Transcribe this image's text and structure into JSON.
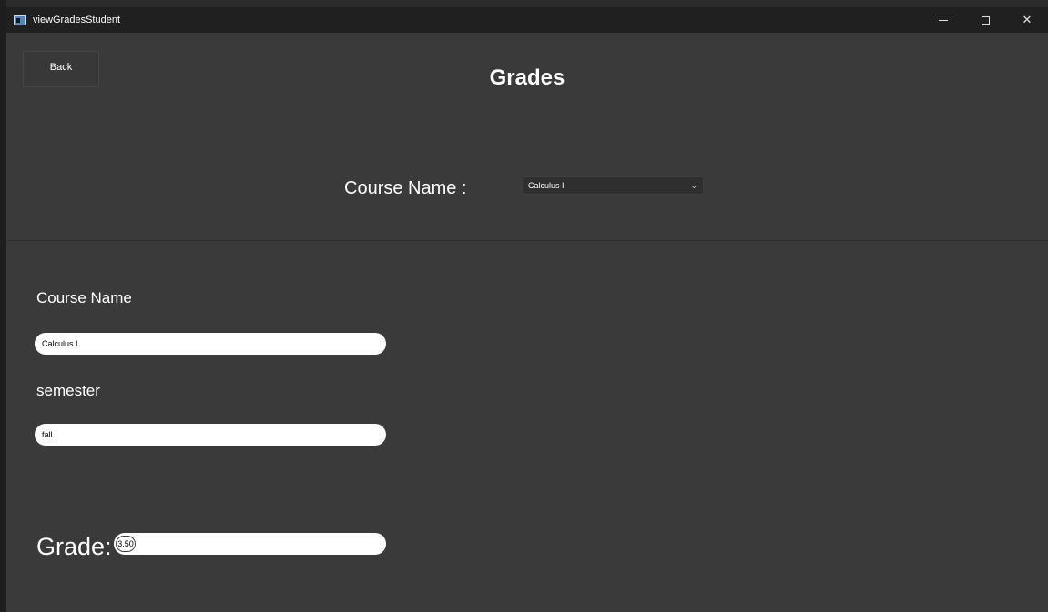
{
  "window": {
    "title": "viewGradesStudent"
  },
  "header": {
    "back_label": "Back",
    "page_title": "Grades"
  },
  "course_selector": {
    "label": "Course Name :",
    "selected": "Calculus I"
  },
  "details": {
    "course_name_label": "Course Name",
    "course_name_value": "Calculus I",
    "semester_label": "semester",
    "semester_value": "fall",
    "grade_label": "Grade:",
    "grade_value": "3.50"
  },
  "icons": {
    "app": "app-window-icon",
    "minimize": "minimize-icon",
    "maximize": "maximize-icon",
    "close": "close-icon",
    "dropdown": "chevron-down-icon"
  }
}
